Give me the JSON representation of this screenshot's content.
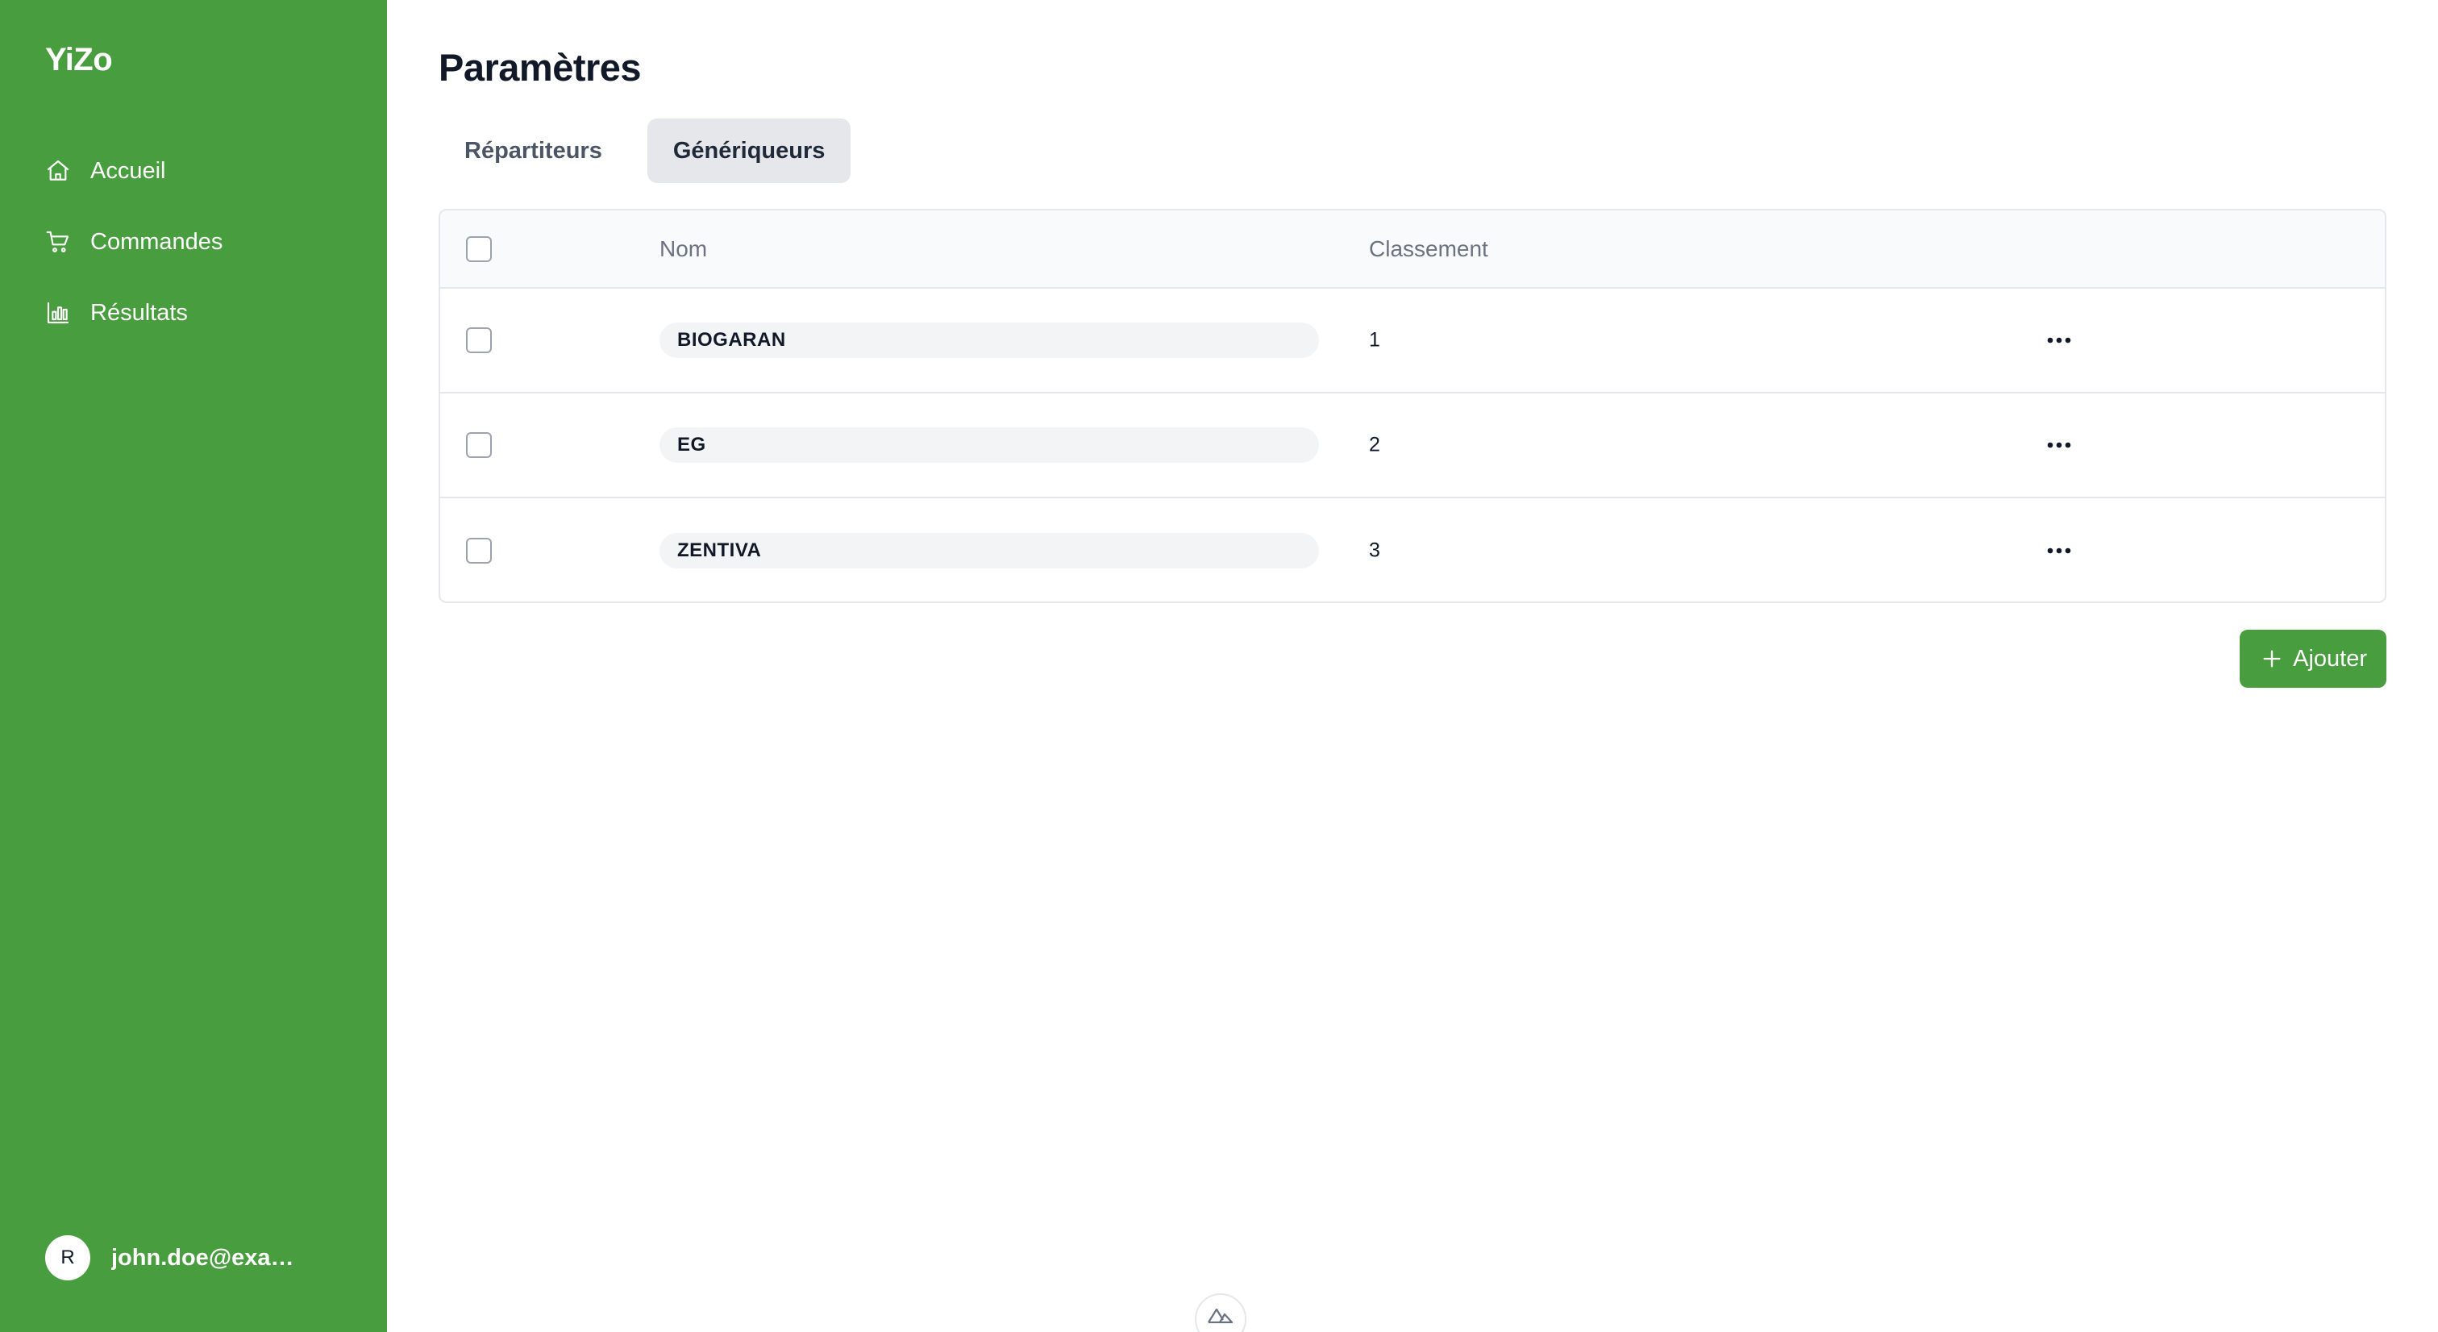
{
  "sidebar": {
    "brand": "YiZo",
    "items": [
      {
        "label": "Accueil",
        "icon": "home-icon"
      },
      {
        "label": "Commandes",
        "icon": "cart-icon"
      },
      {
        "label": "Résultats",
        "icon": "chart-icon"
      }
    ],
    "user": {
      "initial": "R",
      "email": "john.doe@exam..."
    }
  },
  "main": {
    "title": "Paramètres",
    "tabs": [
      {
        "label": "Répartiteurs",
        "active": false
      },
      {
        "label": "Génériqueurs",
        "active": true
      }
    ],
    "table": {
      "columns": [
        "Nom",
        "Classement"
      ],
      "rows": [
        {
          "name": "BIOGARAN",
          "rank": "1"
        },
        {
          "name": "EG",
          "rank": "2"
        },
        {
          "name": "ZENTIVA",
          "rank": "3"
        }
      ]
    },
    "add_button": {
      "label": "Ajouter",
      "icon": "plus-icon"
    }
  },
  "colors": {
    "sidebar_bg": "#489d3e",
    "primary": "#489d3e",
    "active_tab_bg": "#e5e7eb"
  },
  "devtools": {
    "icon": "nuxt-logo-icon"
  }
}
